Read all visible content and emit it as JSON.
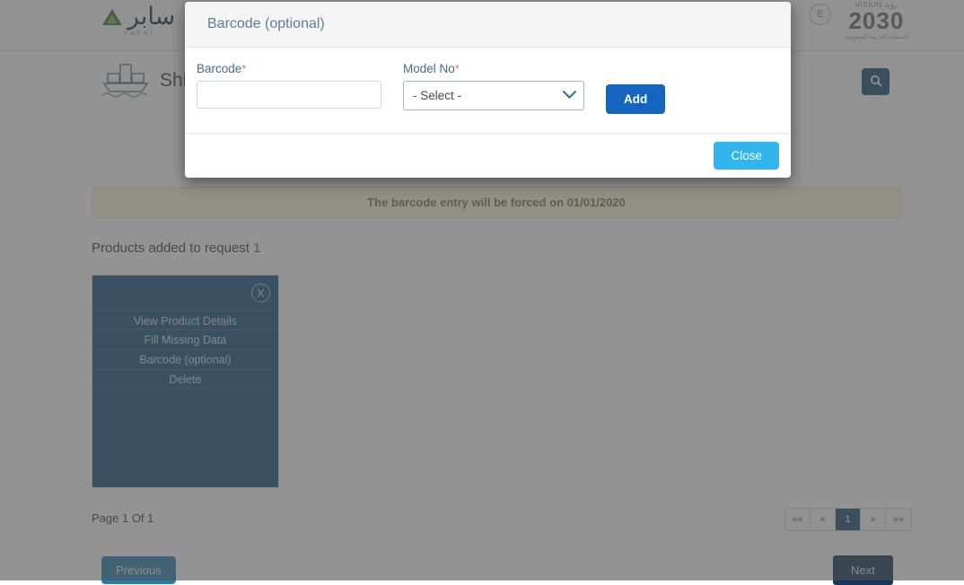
{
  "app": {
    "logo_text": "سابر",
    "logo_sub": "saber",
    "lang_toggle": "E",
    "vision_top": "VISION رؤية",
    "vision_number": "2030",
    "vision_bottom": "المملكة العربية السعودية",
    "page_title": "Shipment",
    "search_icon": "search-icon"
  },
  "banner": {
    "text": "The barcode entry will be forced on 01/01/2020"
  },
  "products": {
    "label": "Products added to request",
    "count": "1",
    "card_menu": {
      "close_label": "X",
      "items": [
        "View Product Details",
        "Fill Missing Data",
        "Barcode (optional)",
        "Delete"
      ]
    }
  },
  "pagination": {
    "page_of": "Page 1 Of 1",
    "first": "««",
    "prev": "«",
    "current": "1",
    "next": "»",
    "last": "»»",
    "previous_button": "Previous",
    "next_button": "Next"
  },
  "modal": {
    "title": "Barcode (optional)",
    "barcode": {
      "label": "Barcode",
      "required_mark": "*",
      "value": "",
      "placeholder": ""
    },
    "model_no": {
      "label": "Model No",
      "required_mark": "*",
      "selected": "- Select -"
    },
    "add_label": "Add",
    "close_label": "Close"
  },
  "colors": {
    "primary_dark": "#1c4d75",
    "accent_blue": "#1565c0",
    "close_blue": "#32b4ec",
    "card_overlay": "#15537f",
    "banner_bg": "#fcf4dd",
    "banner_text": "#8a6d3b"
  }
}
